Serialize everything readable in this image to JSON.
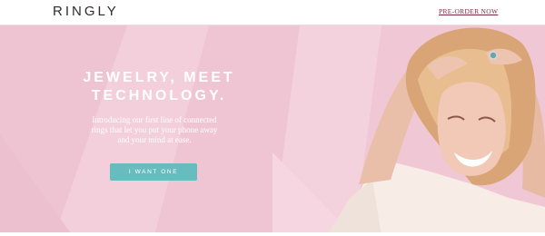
{
  "header": {
    "logo": "RINGLY",
    "preorder_label": "PRE-ORDER NOW"
  },
  "hero": {
    "headline_line1": "JEWELRY, MEET",
    "headline_line2": "TECHNOLOGY.",
    "intro_line1": "Introducing our first line of connected",
    "intro_line2": "rings that let you put your phone away",
    "intro_line3": "and your mind at ease.",
    "cta_label": "I WANT ONE"
  },
  "colors": {
    "hero_background": "#f0c7d5",
    "cta_background": "#66bcbe",
    "preorder_link": "#7a2a3e"
  }
}
